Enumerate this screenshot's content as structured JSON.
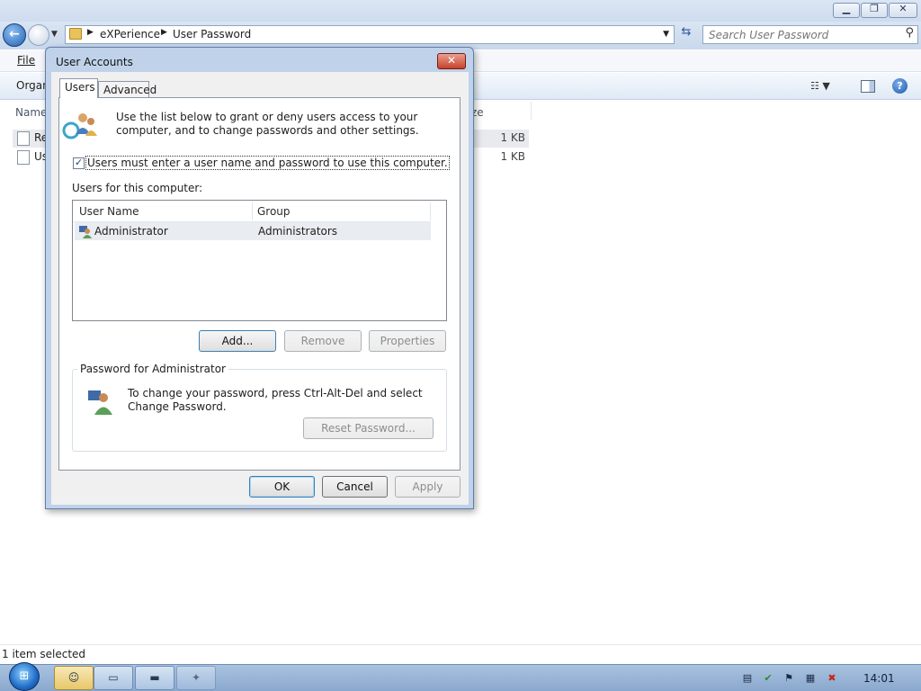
{
  "explorer": {
    "breadcrumb": [
      "eXPerience",
      "User Password"
    ],
    "search": {
      "placeholder": "Search User Password"
    },
    "menu": {
      "file": "File"
    },
    "toolbar": {
      "organize": "Organ"
    },
    "columns": {
      "name": "Name",
      "size": "ze"
    },
    "files": [
      {
        "name": "Re",
        "size": "1 KB",
        "selected": true
      },
      {
        "name": "Us",
        "size": "1 KB",
        "selected": false
      }
    ],
    "status": "1 item selected"
  },
  "dialog": {
    "title": "User Accounts",
    "tabs": [
      {
        "label": "Users",
        "active": true
      },
      {
        "label": "Advanced",
        "active": false
      }
    ],
    "intro": "Use the list below to grant or deny users access to your computer, and to change passwords and other settings.",
    "require_login": {
      "label": "Users must enter a user name and password to use this computer.",
      "checked": true
    },
    "users_label": "Users for this computer:",
    "list": {
      "columns": [
        "User Name",
        "Group"
      ],
      "rows": [
        {
          "user": "Administrator",
          "group": "Administrators"
        }
      ]
    },
    "buttons": {
      "add": "Add...",
      "remove": "Remove",
      "properties": "Properties",
      "reset_password": "Reset Password...",
      "ok": "OK",
      "cancel": "Cancel",
      "apply": "Apply"
    },
    "password_group": {
      "title": "Password for Administrator",
      "text": "To change your password, press Ctrl-Alt-Del and select Change Password."
    }
  },
  "taskbar": {
    "clock": "14:01",
    "buttons": [
      {
        "icon": "user-accounts-icon",
        "active": true
      },
      {
        "icon": "explorer-icon",
        "active": false
      },
      {
        "icon": "command-prompt-icon",
        "active": false
      },
      {
        "icon": "app-icon",
        "active": false
      }
    ],
    "tray_icons": [
      "document-icon",
      "security-center-icon",
      "action-center-flag-icon",
      "network-icon",
      "volume-muted-icon"
    ]
  },
  "colors": {
    "accent": "#1f6cc7",
    "taskbar": "#a9c2df",
    "dialog_frame": "#bfd2e9"
  }
}
